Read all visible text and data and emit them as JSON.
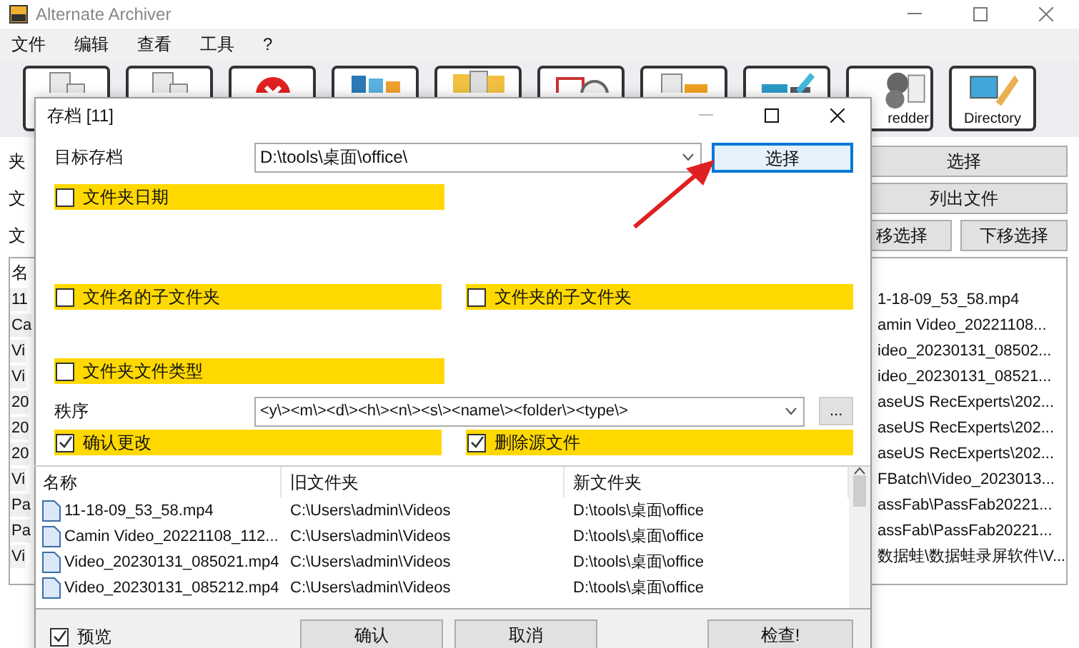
{
  "window": {
    "title": "Alternate Archiver"
  },
  "menu": [
    "文件",
    "编辑",
    "查看",
    "工具",
    "?"
  ],
  "toolbar": [
    {
      "kind": "add"
    },
    {
      "kind": "remove"
    },
    {
      "kind": "delete"
    },
    {
      "kind": "numbers"
    },
    {
      "kind": "letters"
    },
    {
      "kind": "calendar"
    },
    {
      "kind": "file-folder"
    },
    {
      "kind": "folder-edit"
    },
    {
      "kind": "shredder",
      "label": "redder"
    },
    {
      "kind": "directory",
      "label": "Directory"
    }
  ],
  "main": {
    "row_labels": [
      "夹",
      "文",
      "文"
    ],
    "buttons": [
      "选择",
      "列出文件",
      "移选择",
      "下移选择"
    ],
    "list_header": "名",
    "rows": [
      {
        "name": "11",
        "path": "1-18-09_53_58.mp4"
      },
      {
        "name": "Ca",
        "path": "amin Video_20221108..."
      },
      {
        "name": "Vi",
        "path": "ideo_20230131_08502..."
      },
      {
        "name": "Vi",
        "path": "ideo_20230131_08521..."
      },
      {
        "name": "20",
        "path": "aseUS RecExperts\\202..."
      },
      {
        "name": "20",
        "path": "aseUS RecExperts\\202..."
      },
      {
        "name": "20",
        "path": "aseUS RecExperts\\202..."
      },
      {
        "name": "Vi",
        "path": "FBatch\\Video_2023013..."
      },
      {
        "name": "Pa",
        "path": "assFab\\PassFab20221..."
      },
      {
        "name": "Pa",
        "path": "assFab\\PassFab20221..."
      },
      {
        "name": "Vi",
        "path": "数据蛙\\数据蛙录屏软件\\V..."
      }
    ]
  },
  "dialog": {
    "title": "存档 [11]",
    "target_label": "目标存档",
    "target_value": "D:\\tools\\桌面\\office\\",
    "select_button": "选择",
    "options": [
      {
        "label": "文件夹日期",
        "checked": false
      },
      {
        "label": "文件名的子文件夹",
        "checked": false
      },
      {
        "label": "文件夹的子文件夹",
        "checked": false
      },
      {
        "label": "文件夹文件类型",
        "checked": false
      },
      {
        "label": "确认更改",
        "checked": true
      },
      {
        "label": "删除源文件",
        "checked": true
      }
    ],
    "order_label": "秩序",
    "order_value": "<y\\><m\\><d\\><h\\><n\\><s\\><name\\><folder\\><type\\>",
    "more_button": "...",
    "columns": [
      "名称",
      "旧文件夹",
      "新文件夹"
    ],
    "rows": [
      [
        "11-18-09_53_58.mp4",
        "C:\\Users\\admin\\Videos",
        "D:\\tools\\桌面\\office"
      ],
      [
        "Camin Video_20221108_112...",
        "C:\\Users\\admin\\Videos",
        "D:\\tools\\桌面\\office"
      ],
      [
        "Video_20230131_085021.mp4",
        "C:\\Users\\admin\\Videos",
        "D:\\tools\\桌面\\office"
      ],
      [
        "Video_20230131_085212.mp4",
        "C:\\Users\\admin\\Videos",
        "D:\\tools\\桌面\\office"
      ]
    ],
    "preview": {
      "label": "预览",
      "checked": true
    },
    "buttons": [
      "确认",
      "取消",
      "检查!"
    ]
  }
}
